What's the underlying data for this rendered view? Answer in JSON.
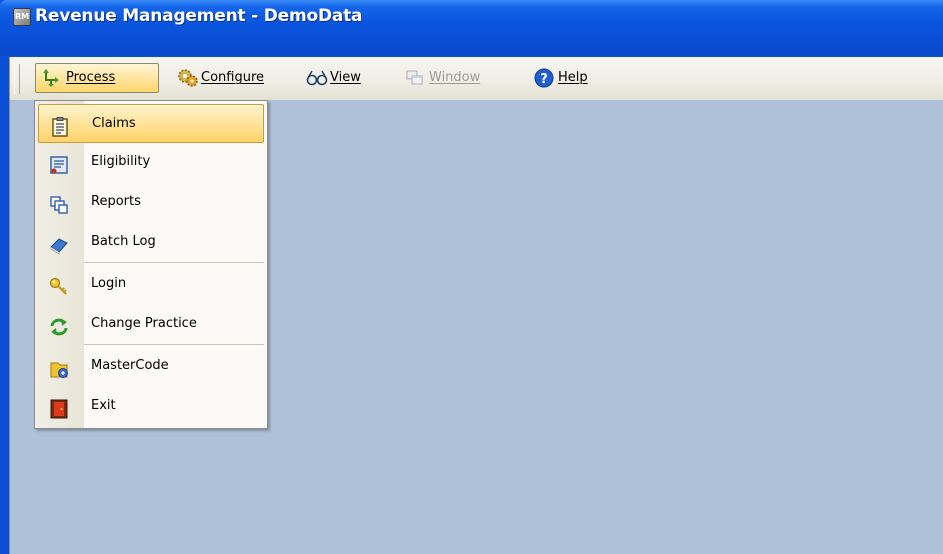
{
  "window": {
    "title": "Revenue Management - DemoData",
    "app_icon_text": "RM"
  },
  "menubar": {
    "process": "Process",
    "configure": "Configure",
    "view": "View",
    "window": "Window",
    "help": "Help"
  },
  "process_menu": {
    "items": [
      {
        "label": "Claims",
        "icon": "claims-icon"
      },
      {
        "label": "Eligibility",
        "icon": "eligibility-icon"
      },
      {
        "label": "Reports",
        "icon": "reports-icon"
      },
      {
        "label": "Batch Log",
        "icon": "batch-log-icon"
      },
      {
        "label": "Login",
        "icon": "key-icon"
      },
      {
        "label": "Change Practice",
        "icon": "refresh-icon"
      },
      {
        "label": "MasterCode",
        "icon": "mastercode-icon"
      },
      {
        "label": "Exit",
        "icon": "exit-door-icon"
      }
    ],
    "selected_index": 0
  },
  "colors": {
    "title_bar": "#0a55de",
    "client_background": "#aec1d9",
    "menu_highlight": "#ffd36a"
  }
}
